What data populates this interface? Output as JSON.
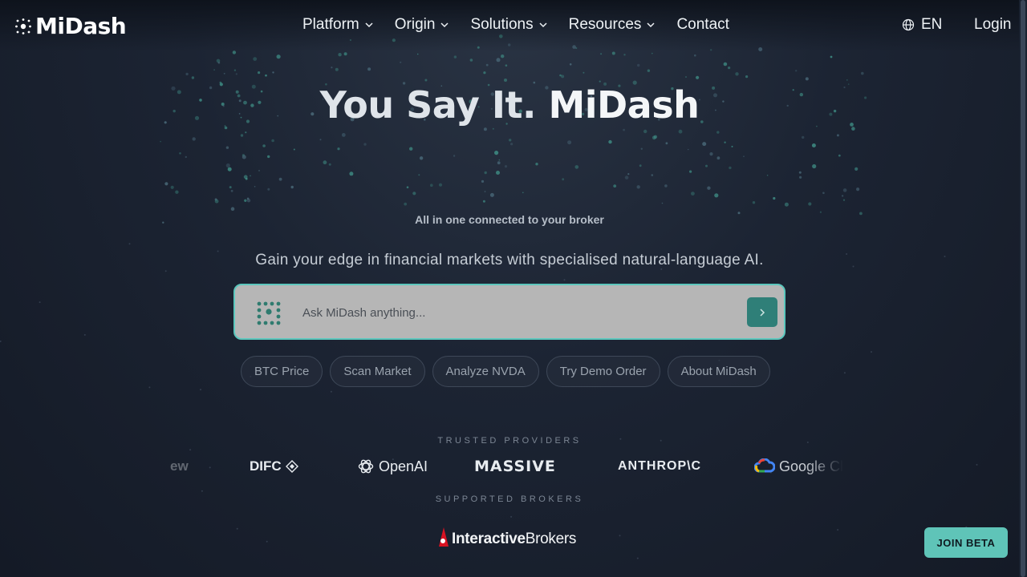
{
  "header": {
    "brand": "MiDash",
    "nav": [
      {
        "label": "Platform"
      },
      {
        "label": "Origin"
      },
      {
        "label": "Solutions"
      },
      {
        "label": "Resources"
      },
      {
        "label": "Contact"
      }
    ],
    "language": "EN",
    "login": "Login"
  },
  "hero": {
    "title_part1": "You Say It.",
    "title_brand": "MiDash",
    "tagline": "All in one connected to your broker",
    "subtitle": "Gain your edge in financial markets with specialised natural-language AI."
  },
  "ask": {
    "placeholder": "Ask MiDash anything..."
  },
  "chips": [
    "BTC Price",
    "Scan Market",
    "Analyze NVDA",
    "Try Demo Order",
    "About MiDash"
  ],
  "providers": {
    "label": "TRUSTED PROVIDERS",
    "items": [
      "ew",
      "DIFC",
      "OpenAI",
      "MASSIVE",
      "ANTHROP\\C",
      "Google Cl"
    ]
  },
  "brokers": {
    "label": "SUPPORTED BROKERS",
    "name_bold": "Interactive",
    "name_regular": "Brokers"
  },
  "cta": {
    "join_beta": "JOIN BETA"
  },
  "colors": {
    "accent": "#5fc4b8",
    "background": "#1c2433"
  }
}
